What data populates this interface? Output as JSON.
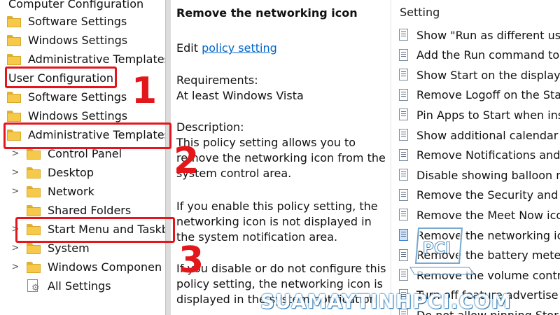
{
  "tree": {
    "items": [
      {
        "label": "Computer Configuration",
        "indent": 0,
        "folder": false,
        "chevron": ""
      },
      {
        "label": "Software Settings",
        "indent": 1,
        "folder": true,
        "chevron": ""
      },
      {
        "label": "Windows Settings",
        "indent": 1,
        "folder": true,
        "chevron": ""
      },
      {
        "label": "Administrative Templates",
        "indent": 1,
        "folder": true,
        "chevron": ""
      },
      {
        "label": "User Configuration",
        "indent": 0,
        "folder": false,
        "chevron": ""
      },
      {
        "label": "Software Settings",
        "indent": 1,
        "folder": true,
        "chevron": ""
      },
      {
        "label": "Windows Settings",
        "indent": 1,
        "folder": true,
        "chevron": ""
      },
      {
        "label": "Administrative Templates",
        "indent": 1,
        "folder": true,
        "chevron": ""
      },
      {
        "label": "Control Panel",
        "indent": 2,
        "folder": true,
        "chevron": ">"
      },
      {
        "label": "Desktop",
        "indent": 2,
        "folder": true,
        "chevron": ">"
      },
      {
        "label": "Network",
        "indent": 2,
        "folder": true,
        "chevron": ">"
      },
      {
        "label": "Shared Folders",
        "indent": 2,
        "folder": true,
        "chevron": ""
      },
      {
        "label": "Start Menu and Taskb",
        "indent": 2,
        "folder": true,
        "chevron": ">"
      },
      {
        "label": "System",
        "indent": 2,
        "folder": true,
        "chevron": ">"
      },
      {
        "label": "Windows Componen",
        "indent": 2,
        "folder": true,
        "chevron": ">"
      },
      {
        "label": "All Settings",
        "indent": 2,
        "folder": false,
        "chevron": ""
      }
    ]
  },
  "description": {
    "title": "Remove the networking icon",
    "edit_prefix": "Edit ",
    "edit_link": "policy setting ",
    "requirements_label": "Requirements:",
    "requirements_value": "At least Windows Vista",
    "description_label": "Description:",
    "paragraph1_l1": "This policy setting allows you to",
    "paragraph1_l2": "remove the networking icon from the",
    "paragraph1_l3": "system control area.",
    "paragraph2_l1": "If you enable this policy setting, the",
    "paragraph2_l2": "networking icon is not displayed in",
    "paragraph2_l3": "the system notification area.",
    "paragraph3_l1": "If you disable or do not configure this",
    "paragraph3_l2": "policy setting, the networking icon is",
    "paragraph3_l3": "displayed in the system notification"
  },
  "settings": {
    "header": "Setting",
    "items": [
      "Show \"Run as different use",
      "Add the Run command to",
      "Show Start on the display",
      "Remove Logoff on the Sta",
      "Pin Apps to Start when ins",
      "Show additional calendar",
      "Remove Notifications and",
      "Disable showing balloon n",
      "Remove the Security and M",
      "Remove the Meet Now ico",
      "Remove the networking ic",
      "Remove the battery meter",
      "Remove the volume contro",
      "Turn off feature advertise",
      "Do not allow pinning Stor"
    ],
    "selected_index": 10
  },
  "annotations": {
    "step1": "1",
    "step2": "2",
    "step3": "3",
    "accent": "#e3161c"
  },
  "watermark": {
    "text": "SUAMAYTINHPCI.COM",
    "logo": "PCI"
  }
}
